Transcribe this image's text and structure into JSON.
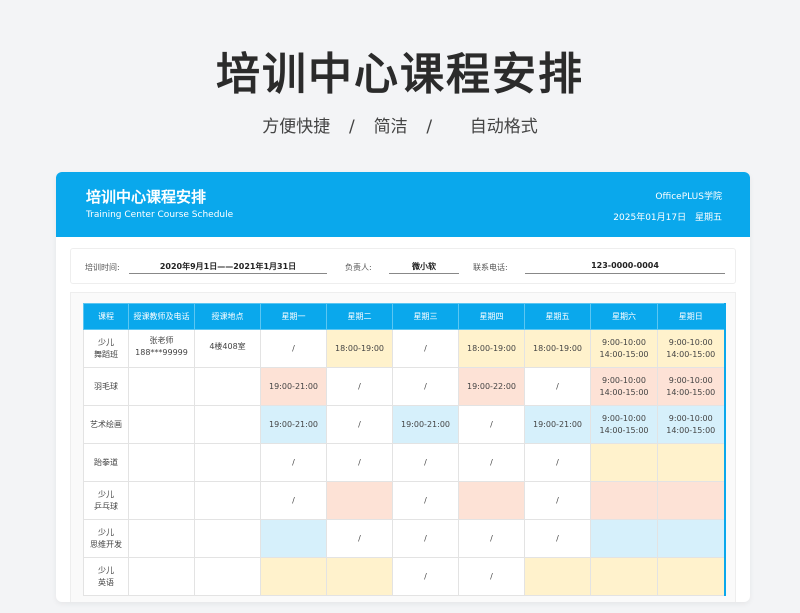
{
  "hero": {
    "title": "培训中心课程安排",
    "subtitle": "方便快捷  /  简洁  /    自动格式"
  },
  "card": {
    "title": "培训中心课程安排",
    "subtitle_en": "Training Center Course Schedule",
    "brand": "OfficePLUS学院",
    "date": "2025年01月17日",
    "weekday": "星期五"
  },
  "info": {
    "period_label": "培训时间:",
    "period_value": "2020年9月1日——2021年1月31日",
    "manager_label": "负责人:",
    "manager_value": "微小软",
    "phone_label": "联系电话:",
    "phone_value": "123-0000-0004"
  },
  "table": {
    "headers": [
      "课程",
      "授课教师及电话",
      "授课地点",
      "星期一",
      "星期二",
      "星期三",
      "星期四",
      "星期五",
      "星期六",
      "星期日"
    ],
    "teacher_name": "张老师",
    "teacher_phone": "188***99999",
    "location": "4楼408室",
    "rows": [
      {
        "course_line1": "少儿",
        "course_line2": "舞蹈班",
        "days": [
          "/",
          "18:00-19:00",
          "/",
          "18:00-19:00",
          "18:00-19:00",
          "9:00-10:00 14:00-15:00",
          "9:00-10:00 14:00-15:00"
        ]
      },
      {
        "course_line1": "羽毛球",
        "course_line2": "",
        "days": [
          "19:00-21:00",
          "/",
          "/",
          "19:00-22:00",
          "/",
          "9:00-10:00 14:00-15:00",
          "9:00-10:00 14:00-15:00"
        ]
      },
      {
        "course_line1": "艺术绘画",
        "course_line2": "",
        "days": [
          "19:00-21:00",
          "/",
          "19:00-21:00",
          "/",
          "19:00-21:00",
          "9:00-10:00 14:00-15:00",
          "9:00-10:00 14:00-15:00"
        ]
      },
      {
        "course_line1": "跆拳道",
        "course_line2": "",
        "days": [
          "/",
          "/",
          "/",
          "/",
          "/",
          "",
          ""
        ]
      },
      {
        "course_line1": "少儿",
        "course_line2": "乒乓球",
        "days": [
          "/",
          "",
          "/",
          "",
          "/",
          "",
          ""
        ]
      },
      {
        "course_line1": "少儿",
        "course_line2": "思维开发",
        "days": [
          "",
          "/",
          "/",
          "/",
          "/",
          "",
          ""
        ]
      },
      {
        "course_line1": "少儿",
        "course_line2": "英语",
        "days": [
          "",
          "",
          "/",
          "/",
          "",
          "",
          ""
        ]
      }
    ],
    "row_colors": [
      [
        "w",
        "y",
        "w",
        "y",
        "y",
        "y",
        "y"
      ],
      [
        "p",
        "w",
        "w",
        "p",
        "w",
        "p",
        "p"
      ],
      [
        "b",
        "w",
        "b",
        "w",
        "b",
        "b",
        "b"
      ],
      [
        "w",
        "w",
        "w",
        "w",
        "w",
        "y",
        "y"
      ],
      [
        "w",
        "p",
        "w",
        "p",
        "w",
        "p",
        "p"
      ],
      [
        "b",
        "w",
        "w",
        "w",
        "w",
        "b",
        "b"
      ],
      [
        "y",
        "y",
        "w",
        "w",
        "y",
        "y",
        "y"
      ]
    ]
  },
  "colors": {
    "header_blue": "#0aa8ec",
    "cell_yellow": "#fff2cc",
    "cell_pink": "#fde2d6",
    "cell_blue": "#d6f0fb"
  }
}
